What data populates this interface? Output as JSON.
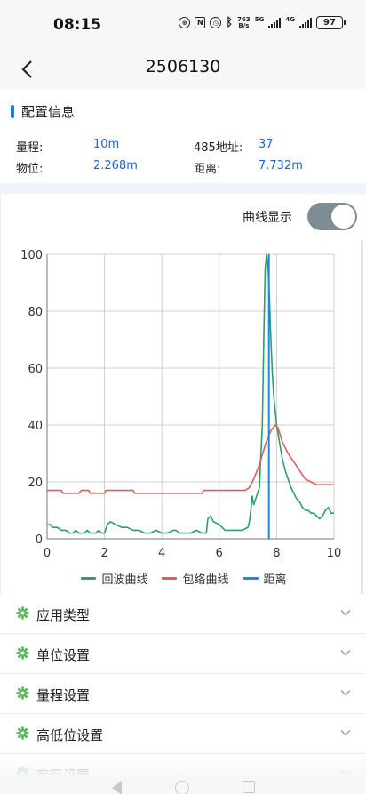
{
  "status_bar": {
    "time": "08:15",
    "net_speed_value": "763",
    "net_speed_unit": "B/s",
    "net_type_1": "5G",
    "net_type_2": "4G",
    "battery": "97"
  },
  "header": {
    "title": "2506130",
    "back_icon": "chevron-left-icon"
  },
  "config": {
    "section_title": "配置信息",
    "accent_color": "#1677ff",
    "value_color": "#1a63d6",
    "range_label": "量程:",
    "range_value": "10m",
    "address_label": "485地址:",
    "address_value": "37",
    "level_label": "物位:",
    "level_value": "2.268m",
    "distance_label": "距离:",
    "distance_value": "7.732m"
  },
  "curve": {
    "toggle_label": "曲线显示",
    "toggle_on": true
  },
  "chart_data": {
    "type": "line",
    "title": "",
    "xlabel": "",
    "ylabel": "",
    "xlim": [
      0,
      10
    ],
    "ylim": [
      0,
      100
    ],
    "x_ticks": [
      "0",
      "2",
      "4",
      "6",
      "8",
      "10"
    ],
    "y_ticks": [
      "0",
      "20",
      "40",
      "60",
      "80",
      "100"
    ],
    "grid": true,
    "legend_position": "bottom",
    "series": [
      {
        "name": "回波曲线",
        "color": "#2e9e6a",
        "points": [
          [
            0,
            5
          ],
          [
            0.1,
            5
          ],
          [
            0.2,
            4
          ],
          [
            0.35,
            4
          ],
          [
            0.5,
            3
          ],
          [
            0.65,
            3
          ],
          [
            0.8,
            2
          ],
          [
            0.9,
            2
          ],
          [
            1.0,
            3
          ],
          [
            1.1,
            2
          ],
          [
            1.3,
            2
          ],
          [
            1.4,
            3
          ],
          [
            1.5,
            2
          ],
          [
            1.7,
            2
          ],
          [
            1.8,
            3
          ],
          [
            1.9,
            2
          ],
          [
            2.0,
            2
          ],
          [
            2.1,
            5
          ],
          [
            2.2,
            6
          ],
          [
            2.4,
            5
          ],
          [
            2.6,
            4
          ],
          [
            2.8,
            4
          ],
          [
            3.0,
            3
          ],
          [
            3.2,
            3
          ],
          [
            3.4,
            2
          ],
          [
            3.6,
            2
          ],
          [
            3.8,
            3
          ],
          [
            4.0,
            2
          ],
          [
            4.2,
            2
          ],
          [
            4.4,
            3
          ],
          [
            4.5,
            3
          ],
          [
            4.6,
            2
          ],
          [
            4.8,
            2
          ],
          [
            5.0,
            2
          ],
          [
            5.2,
            3
          ],
          [
            5.4,
            2
          ],
          [
            5.55,
            2
          ],
          [
            5.6,
            7
          ],
          [
            5.7,
            8
          ],
          [
            5.8,
            6
          ],
          [
            6.0,
            5
          ],
          [
            6.2,
            3
          ],
          [
            6.4,
            3
          ],
          [
            6.6,
            3
          ],
          [
            6.8,
            3
          ],
          [
            7.0,
            4
          ],
          [
            7.05,
            6
          ],
          [
            7.1,
            10
          ],
          [
            7.15,
            15
          ],
          [
            7.2,
            12
          ],
          [
            7.3,
            15
          ],
          [
            7.4,
            18
          ],
          [
            7.5,
            40
          ],
          [
            7.55,
            70
          ],
          [
            7.6,
            95
          ],
          [
            7.65,
            100
          ],
          [
            7.7,
            96
          ],
          [
            7.75,
            85
          ],
          [
            7.8,
            70
          ],
          [
            7.85,
            58
          ],
          [
            7.9,
            50
          ],
          [
            8.0,
            40
          ],
          [
            8.1,
            34
          ],
          [
            8.2,
            28
          ],
          [
            8.3,
            24
          ],
          [
            8.4,
            21
          ],
          [
            8.5,
            18
          ],
          [
            8.6,
            16
          ],
          [
            8.7,
            14
          ],
          [
            8.8,
            13
          ],
          [
            8.9,
            11
          ],
          [
            9.0,
            10
          ],
          [
            9.1,
            10
          ],
          [
            9.2,
            9
          ],
          [
            9.3,
            9
          ],
          [
            9.4,
            8
          ],
          [
            9.5,
            7
          ],
          [
            9.6,
            8
          ],
          [
            9.7,
            10
          ],
          [
            9.8,
            11
          ],
          [
            9.9,
            9
          ],
          [
            10,
            9
          ]
        ]
      },
      {
        "name": "包络曲线",
        "color": "#e05c5c",
        "points": [
          [
            0,
            17
          ],
          [
            0.5,
            17
          ],
          [
            0.55,
            16
          ],
          [
            1.1,
            16
          ],
          [
            1.2,
            17
          ],
          [
            1.45,
            17
          ],
          [
            1.5,
            16
          ],
          [
            2.0,
            16
          ],
          [
            2.05,
            17
          ],
          [
            3.0,
            17
          ],
          [
            3.05,
            16
          ],
          [
            5.4,
            16
          ],
          [
            5.45,
            17
          ],
          [
            6.9,
            17
          ],
          [
            7.05,
            18
          ],
          [
            7.2,
            21
          ],
          [
            7.4,
            26
          ],
          [
            7.6,
            33
          ],
          [
            7.8,
            38
          ],
          [
            7.95,
            40
          ],
          [
            8.05,
            39
          ],
          [
            8.2,
            34
          ],
          [
            8.4,
            30
          ],
          [
            8.6,
            27
          ],
          [
            8.8,
            24
          ],
          [
            9.0,
            21
          ],
          [
            9.2,
            20
          ],
          [
            9.4,
            19
          ],
          [
            9.6,
            19
          ],
          [
            10,
            19
          ]
        ]
      },
      {
        "name": "距离",
        "color": "#1e88e5",
        "points": [
          [
            7.732,
            0
          ],
          [
            7.732,
            100
          ]
        ]
      }
    ]
  },
  "settings": {
    "items": [
      {
        "label": "应用类型"
      },
      {
        "label": "单位设置"
      },
      {
        "label": "量程设置"
      },
      {
        "label": "高低位设置"
      },
      {
        "label": "盲区设置"
      }
    ],
    "gear_color": "#5bb85d",
    "icon": "gear-icon",
    "chevron_icon": "chevron-down-icon"
  }
}
